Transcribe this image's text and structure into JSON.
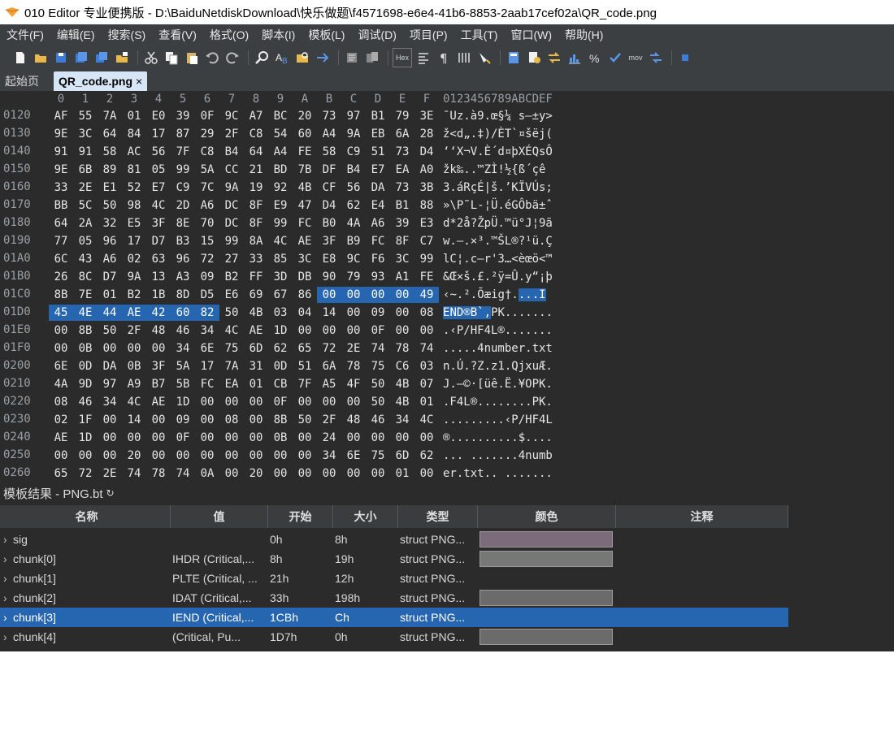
{
  "window": {
    "title": "010 Editor 专业便携版 - D:\\BaiduNetdiskDownload\\快乐做题\\f4571698-e6e4-41b6-8853-2aab17cef02a\\QR_code.png"
  },
  "menu": [
    "文件(F)",
    "编辑(E)",
    "搜索(S)",
    "查看(V)",
    "格式(O)",
    "脚本(I)",
    "模板(L)",
    "调试(D)",
    "项目(P)",
    "工具(T)",
    "窗口(W)",
    "帮助(H)"
  ],
  "toolbar": {
    "hex_label": "Hex",
    "mov_label": "mov"
  },
  "tabs": {
    "start": "起始页",
    "file": "QR_code.png",
    "close": "×"
  },
  "hex": {
    "columns": [
      "0",
      "1",
      "2",
      "3",
      "4",
      "5",
      "6",
      "7",
      "8",
      "9",
      "A",
      "B",
      "C",
      "D",
      "E",
      "F"
    ],
    "ascii_header": "0123456789ABCDEF",
    "rows": [
      {
        "addr": "0120",
        "bytes": [
          "AF",
          "55",
          "7A",
          "01",
          "E0",
          "39",
          "0F",
          "9C",
          "A7",
          "BC",
          "20",
          "73",
          "97",
          "B1",
          "79",
          "3E"
        ],
        "ascii": "¯Uz.à9.œ§¼ s—±y>"
      },
      {
        "addr": "0130",
        "bytes": [
          "9E",
          "3C",
          "64",
          "84",
          "17",
          "87",
          "29",
          "2F",
          "C8",
          "54",
          "60",
          "A4",
          "9A",
          "EB",
          "6A",
          "28"
        ],
        "ascii": "ž<d„.‡)/ÈT`¤šëj("
      },
      {
        "addr": "0140",
        "bytes": [
          "91",
          "91",
          "58",
          "AC",
          "56",
          "7F",
          "C8",
          "B4",
          "64",
          "A4",
          "FE",
          "58",
          "C9",
          "51",
          "73",
          "D4"
        ],
        "ascii": "‘‘X¬V.È´d¤þXÉQsÔ"
      },
      {
        "addr": "0150",
        "bytes": [
          "9E",
          "6B",
          "89",
          "81",
          "05",
          "99",
          "5A",
          "CC",
          "21",
          "BD",
          "7B",
          "DF",
          "B4",
          "E7",
          "EA",
          "A0"
        ],
        "ascii": "žk‰..™ZÌ!½{ß´çê "
      },
      {
        "addr": "0160",
        "bytes": [
          "33",
          "2E",
          "E1",
          "52",
          "E7",
          "C9",
          "7C",
          "9A",
          "19",
          "92",
          "4B",
          "CF",
          "56",
          "DA",
          "73",
          "3B"
        ],
        "ascii": "3.áRçÉ|š.’KÏVÚs;"
      },
      {
        "addr": "0170",
        "bytes": [
          "BB",
          "5C",
          "50",
          "98",
          "4C",
          "2D",
          "A6",
          "DC",
          "8F",
          "E9",
          "47",
          "D4",
          "62",
          "E4",
          "B1",
          "88"
        ],
        "ascii": "»\\P˜L-¦Ü.éGÔbä±ˆ"
      },
      {
        "addr": "0180",
        "bytes": [
          "64",
          "2A",
          "32",
          "E5",
          "3F",
          "8E",
          "70",
          "DC",
          "8F",
          "99",
          "FC",
          "B0",
          "4A",
          "A6",
          "39",
          "E3"
        ],
        "ascii": "d*2å?ŽpÜ.™ü°J¦9ã"
      },
      {
        "addr": "0190",
        "bytes": [
          "77",
          "05",
          "96",
          "17",
          "D7",
          "B3",
          "15",
          "99",
          "8A",
          "4C",
          "AE",
          "3F",
          "B9",
          "FC",
          "8F",
          "C7"
        ],
        "ascii": "w.–.×³.™ŠL®?¹ü.Ç"
      },
      {
        "addr": "01A0",
        "bytes": [
          "6C",
          "43",
          "A6",
          "02",
          "63",
          "96",
          "72",
          "27",
          "33",
          "85",
          "3C",
          "E8",
          "9C",
          "F6",
          "3C",
          "99"
        ],
        "ascii": "lC¦.c–r'3…<èœö<™"
      },
      {
        "addr": "01B0",
        "bytes": [
          "26",
          "8C",
          "D7",
          "9A",
          "13",
          "A3",
          "09",
          "B2",
          "FF",
          "3D",
          "DB",
          "90",
          "79",
          "93",
          "A1",
          "FE"
        ],
        "ascii": "&Œ×š.£.²ÿ=Û.y“¡þ"
      },
      {
        "addr": "01C0",
        "bytes": [
          "8B",
          "7E",
          "01",
          "B2",
          "1B",
          "8D",
          "D5",
          "E6",
          "69",
          "67",
          "86",
          "00",
          "00",
          "00",
          "00",
          "49"
        ],
        "ascii": "‹~.².Õæig†....I",
        "sel_from": 11
      },
      {
        "addr": "01D0",
        "bytes": [
          "45",
          "4E",
          "44",
          "AE",
          "42",
          "60",
          "82",
          "50",
          "4B",
          "03",
          "04",
          "14",
          "00",
          "09",
          "00",
          "08"
        ],
        "ascii": "END®B`‚PK.......",
        "sel_to": 6
      },
      {
        "addr": "01E0",
        "bytes": [
          "00",
          "8B",
          "50",
          "2F",
          "48",
          "46",
          "34",
          "4C",
          "AE",
          "1D",
          "00",
          "00",
          "00",
          "0F",
          "00",
          "00"
        ],
        "ascii": ".‹P/HF4L®......."
      },
      {
        "addr": "01F0",
        "bytes": [
          "00",
          "0B",
          "00",
          "00",
          "00",
          "34",
          "6E",
          "75",
          "6D",
          "62",
          "65",
          "72",
          "2E",
          "74",
          "78",
          "74"
        ],
        "ascii": ".....4number.txt"
      },
      {
        "addr": "0200",
        "bytes": [
          "6E",
          "0D",
          "DA",
          "0B",
          "3F",
          "5A",
          "17",
          "7A",
          "31",
          "0D",
          "51",
          "6A",
          "78",
          "75",
          "C6",
          "03"
        ],
        "ascii": "n.Ú.?Z.z1.QjxuÆ."
      },
      {
        "addr": "0210",
        "bytes": [
          "4A",
          "9D",
          "97",
          "A9",
          "B7",
          "5B",
          "FC",
          "EA",
          "01",
          "CB",
          "7F",
          "A5",
          "4F",
          "50",
          "4B",
          "07"
        ],
        "ascii": "J.—©·[üê.Ë.¥OPK."
      },
      {
        "addr": "0220",
        "bytes": [
          "08",
          "46",
          "34",
          "4C",
          "AE",
          "1D",
          "00",
          "00",
          "00",
          "0F",
          "00",
          "00",
          "00",
          "50",
          "4B",
          "01"
        ],
        "ascii": ".F4L®........PK."
      },
      {
        "addr": "0230",
        "bytes": [
          "02",
          "1F",
          "00",
          "14",
          "00",
          "09",
          "00",
          "08",
          "00",
          "8B",
          "50",
          "2F",
          "48",
          "46",
          "34",
          "4C"
        ],
        "ascii": ".........‹P/HF4L"
      },
      {
        "addr": "0240",
        "bytes": [
          "AE",
          "1D",
          "00",
          "00",
          "00",
          "0F",
          "00",
          "00",
          "00",
          "0B",
          "00",
          "24",
          "00",
          "00",
          "00",
          "00"
        ],
        "ascii": "®..........$...."
      },
      {
        "addr": "0250",
        "bytes": [
          "00",
          "00",
          "00",
          "20",
          "00",
          "00",
          "00",
          "00",
          "00",
          "00",
          "00",
          "34",
          "6E",
          "75",
          "6D",
          "62"
        ],
        "ascii": "... .......4numb"
      },
      {
        "addr": "0260",
        "bytes": [
          "65",
          "72",
          "2E",
          "74",
          "78",
          "74",
          "0A",
          "00",
          "20",
          "00",
          "00",
          "00",
          "00",
          "00",
          "01",
          "00"
        ],
        "ascii": "er.txt.. ......."
      }
    ]
  },
  "template": {
    "title": "模板结果 - PNG.bt",
    "refresh": "↻",
    "headers": {
      "name": "名称",
      "value": "值",
      "start": "开始",
      "size": "大小",
      "type": "类型",
      "color": "颜色",
      "comment": "注释"
    },
    "rows": [
      {
        "name": "sig",
        "value": "",
        "start": "0h",
        "size": "8h",
        "type": "struct PNG...",
        "swatch": "#7b6b7b"
      },
      {
        "name": "chunk[0]",
        "value": "IHDR  (Critical,...",
        "start": "8h",
        "size": "19h",
        "type": "struct PNG...",
        "swatch": "#777777"
      },
      {
        "name": "chunk[1]",
        "value": "PLTE  (Critical, ...",
        "start": "21h",
        "size": "12h",
        "type": "struct PNG...",
        "swatch": ""
      },
      {
        "name": "chunk[2]",
        "value": "IDAT  (Critical,...",
        "start": "33h",
        "size": "198h",
        "type": "struct PNG...",
        "swatch": "#6b6b6b"
      },
      {
        "name": "chunk[3]",
        "value": "IEND  (Critical,...",
        "start": "1CBh",
        "size": "Ch",
        "type": "struct PNG...",
        "swatch": "",
        "selected": true
      },
      {
        "name": "chunk[4]",
        "value": "  (Critical, Pu...",
        "start": "1D7h",
        "size": "0h",
        "type": "struct PNG...",
        "swatch": "#6b6b6b"
      }
    ]
  },
  "colors": {
    "accent": "#2666b0",
    "editor_bg": "#2b2b2b",
    "chrome_bg": "#3c3f41"
  }
}
